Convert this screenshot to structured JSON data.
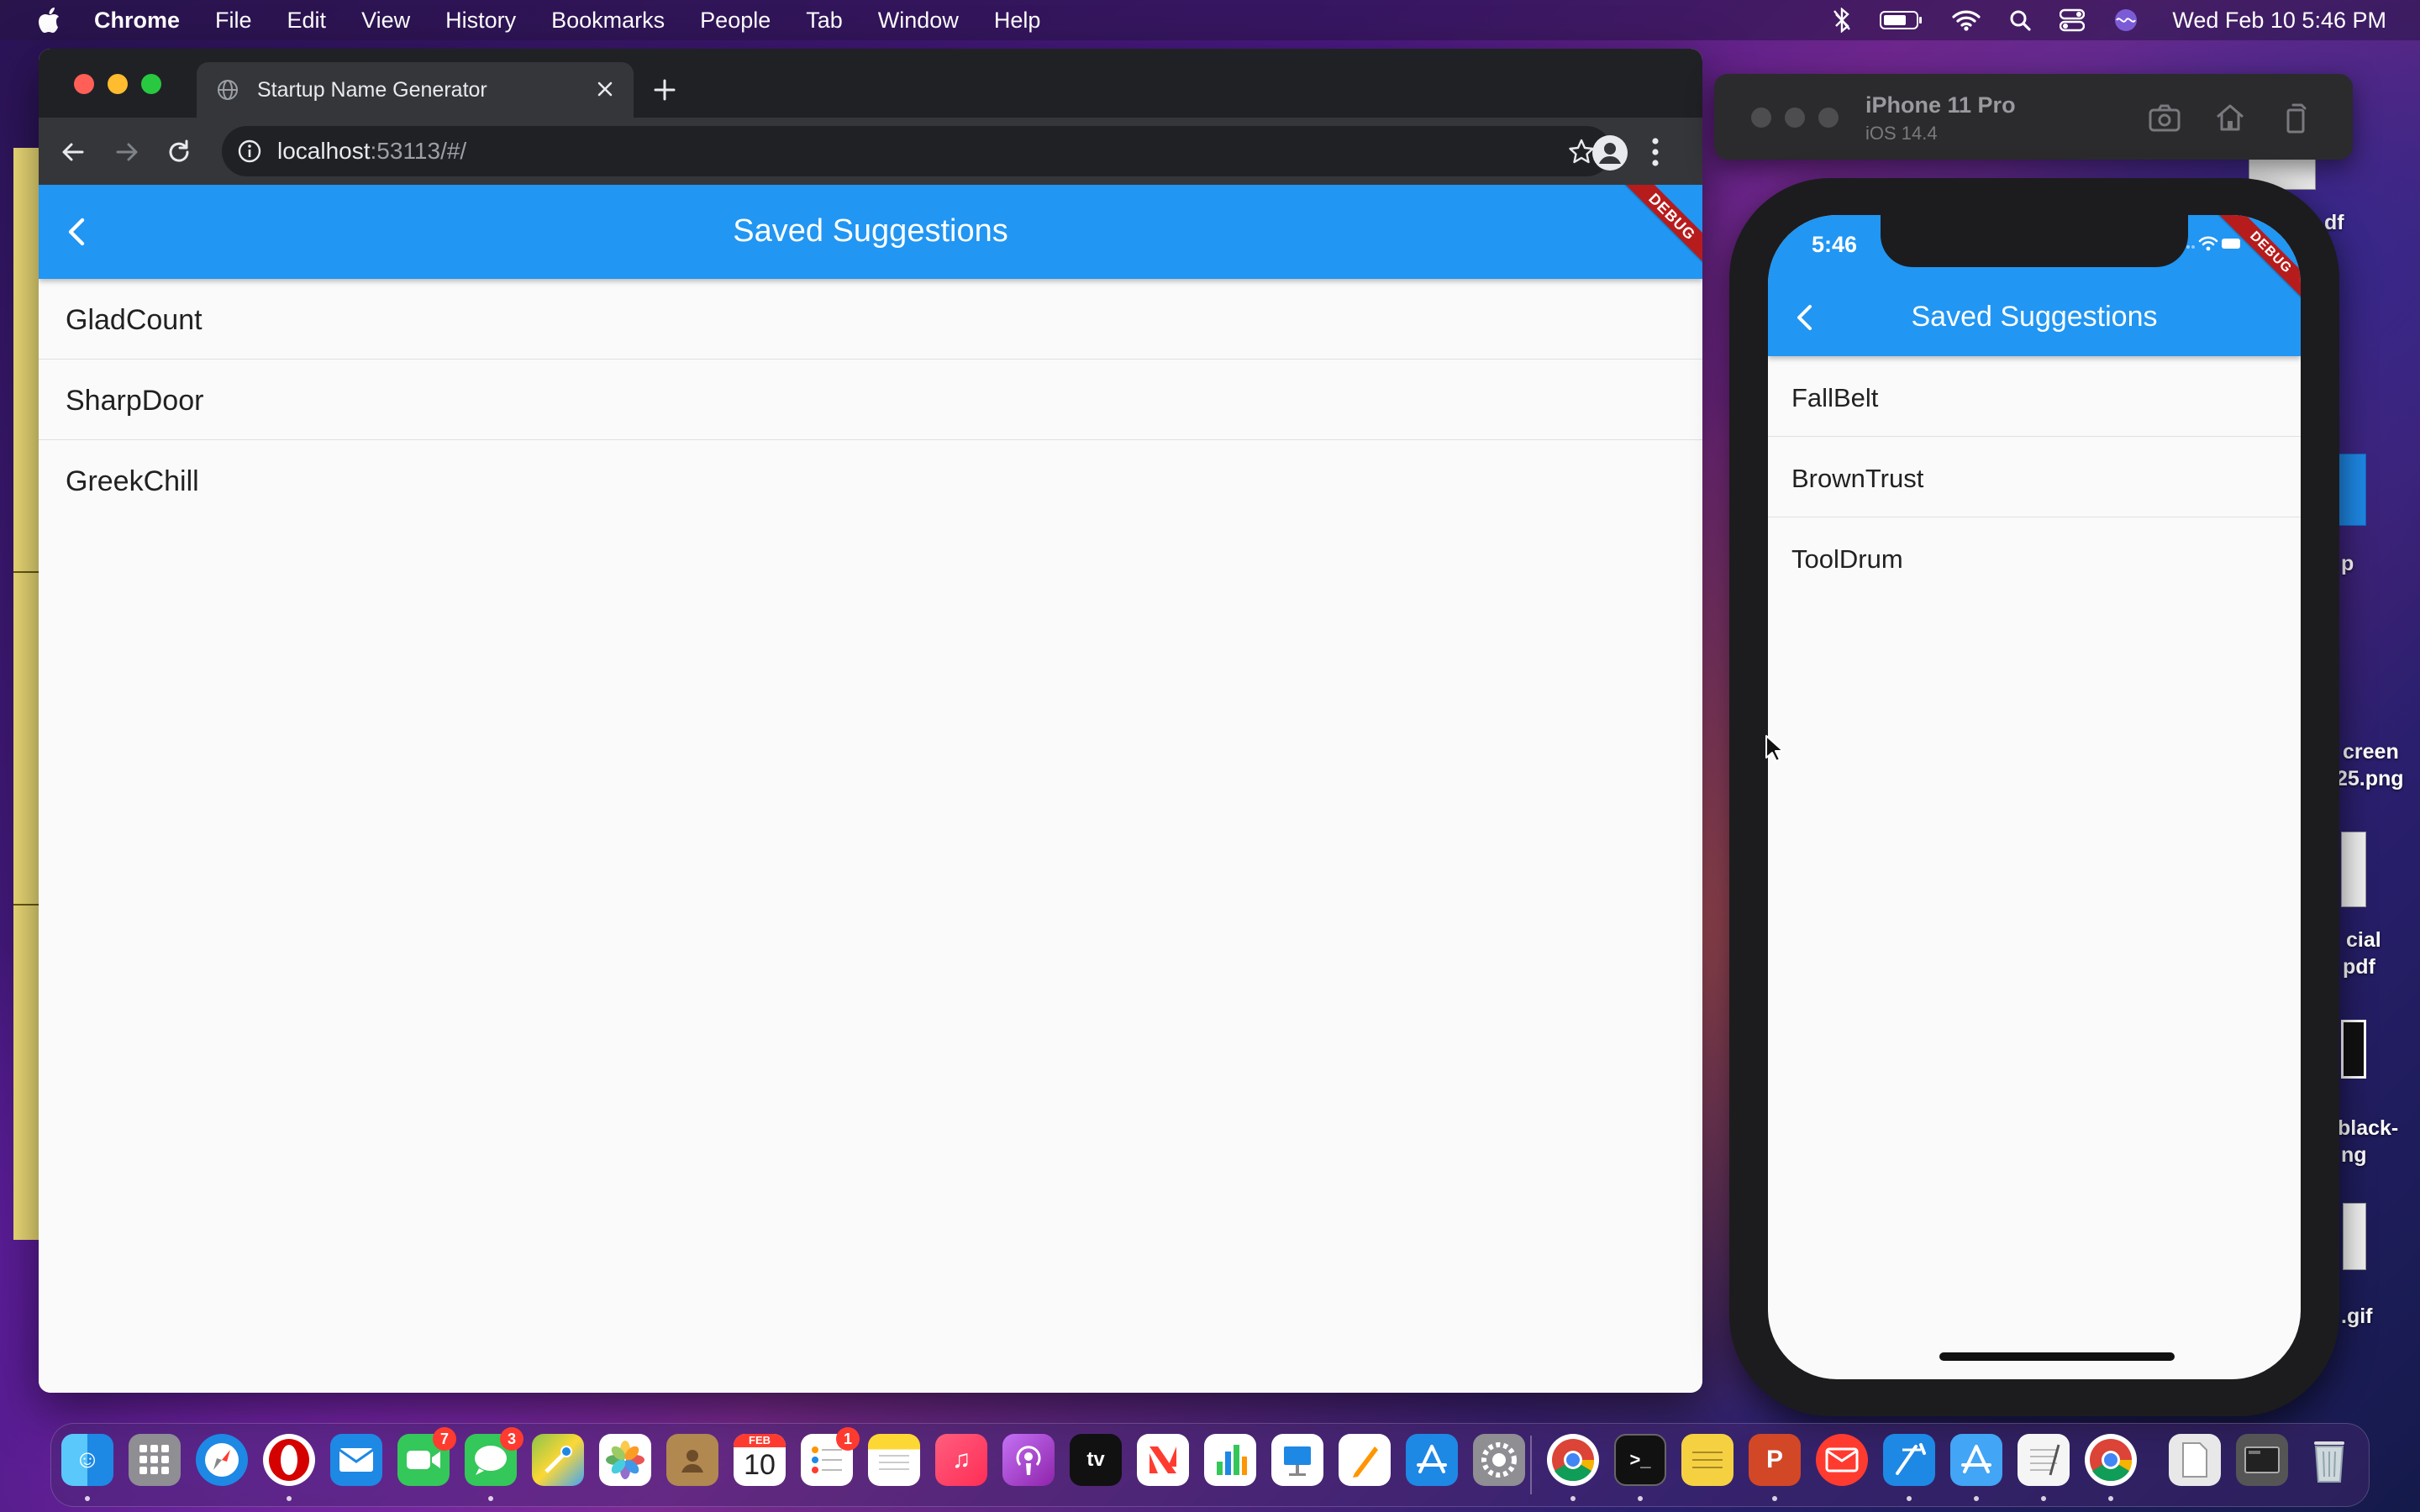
{
  "menubar": {
    "app_name": "Chrome",
    "items": [
      "File",
      "Edit",
      "View",
      "History",
      "Bookmarks",
      "People",
      "Tab",
      "Window",
      "Help"
    ],
    "clock": "Wed Feb 10  5:46 PM"
  },
  "desktop": {
    "labels": [
      "df",
      "p",
      "creen",
      "25.png",
      "cial",
      "pdf",
      "black-",
      "ng",
      ".gif"
    ]
  },
  "browser": {
    "tab_title": "Startup Name Generator",
    "url_host": "localhost",
    "url_rest": ":53113/#/"
  },
  "web_app": {
    "app_bar_title": "Saved Suggestions",
    "debug_banner": "DEBUG",
    "saved": [
      "GladCount",
      "SharpDoor",
      "GreekChill"
    ]
  },
  "simulator": {
    "device_name": "iPhone 11 Pro",
    "os_version": "iOS 14.4",
    "status_time": "5:46",
    "app_bar_title": "Saved Suggestions",
    "debug_banner": "DEBUG",
    "saved": [
      "FallBelt",
      "BrownTrust",
      "ToolDrum"
    ]
  },
  "dock": {
    "badges": {
      "facetime": "7",
      "messages": "3",
      "reminders": "1"
    },
    "calendar": {
      "month": "FEB",
      "day": "10"
    },
    "tv_label": "tv",
    "app_icons": [
      "finder-icon",
      "launchpad-icon",
      "safari-icon",
      "opera-icon",
      "mail-icon",
      "facetime-icon",
      "messages-icon",
      "maps-icon",
      "photos-icon",
      "contacts-icon",
      "calendar-icon",
      "reminders-icon",
      "notes-icon",
      "music-icon",
      "podcasts-icon",
      "tv-icon",
      "news-icon",
      "numbers-icon",
      "keynote-icon",
      "pages-icon",
      "app-store-icon",
      "system-preferences-icon",
      "chrome-icon",
      "terminal-icon",
      "stickies-icon",
      "powerpoint-icon",
      "airmail-icon",
      "xcode-icon",
      "simulator-icon",
      "textedit-icon",
      "chrome-canary-icon",
      "documents-folder-icon",
      "screenshots-folder-icon",
      "trash-icon"
    ]
  },
  "colors": {
    "flutter_blue": "#2196f3",
    "chrome_dark": "#35363a",
    "debug_red": "#b71c1c"
  }
}
